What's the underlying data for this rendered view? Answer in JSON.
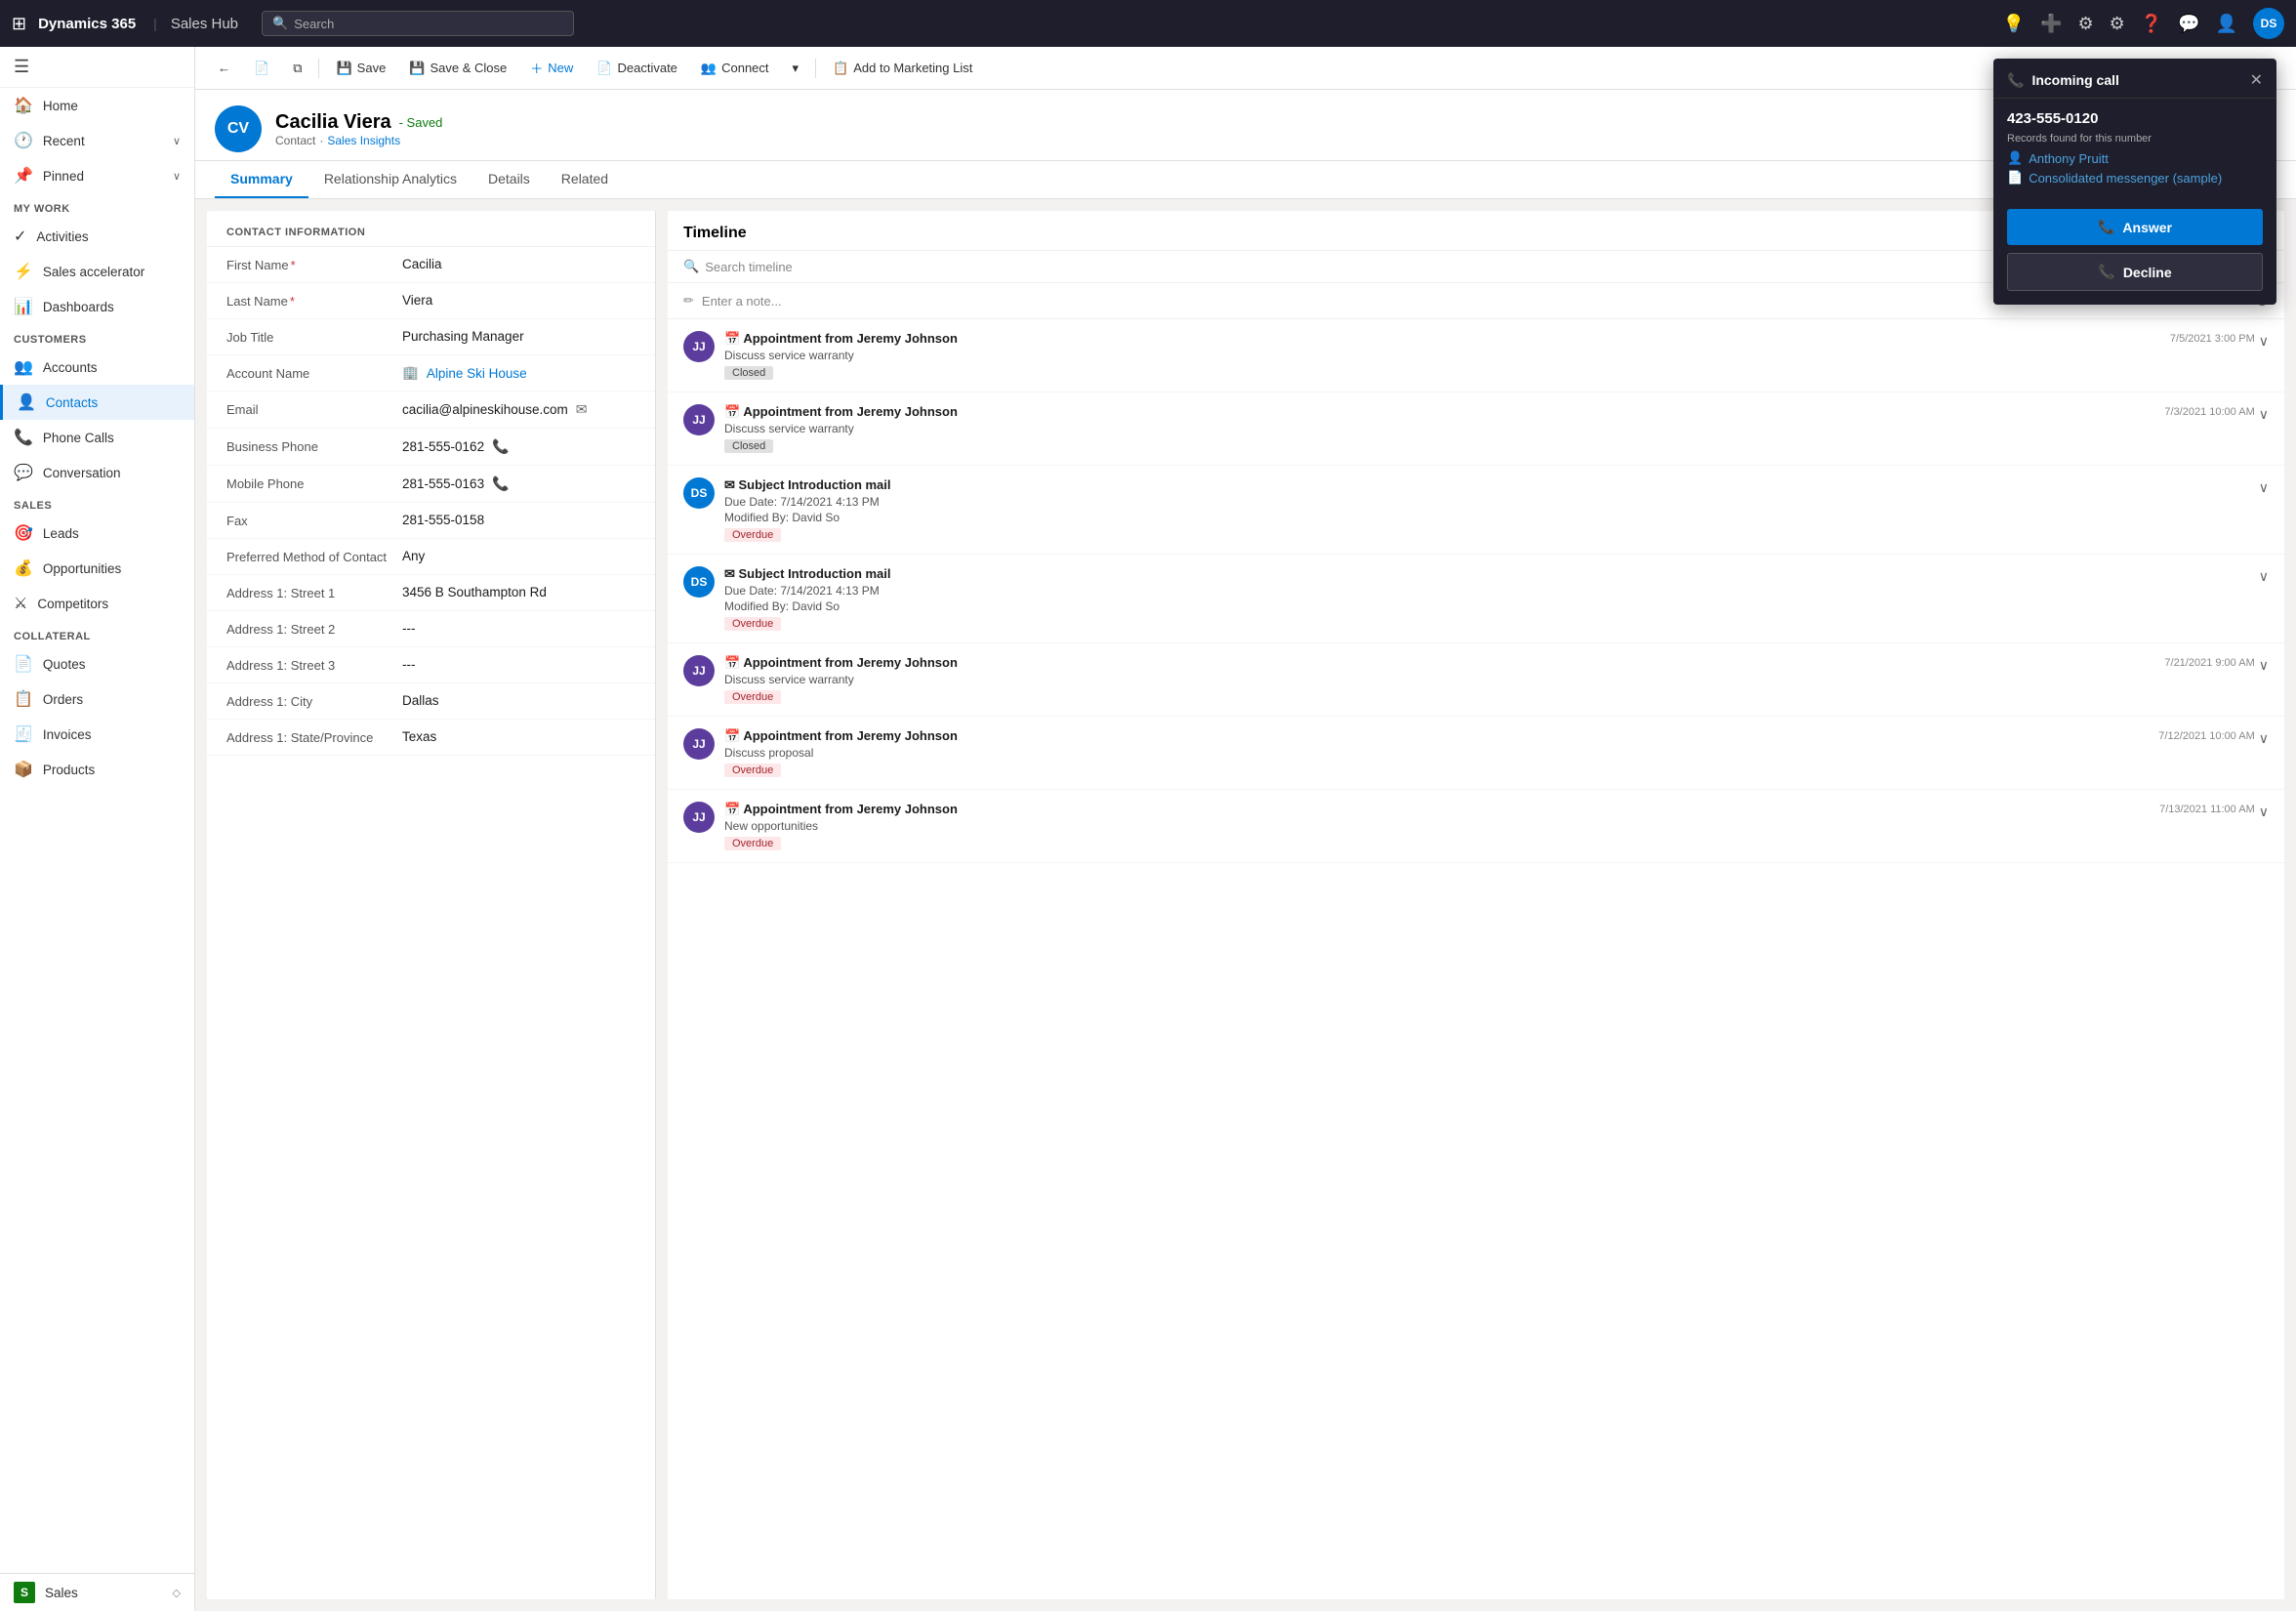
{
  "topNav": {
    "appName": "Dynamics 365",
    "hubName": "Sales Hub",
    "searchPlaceholder": "Search",
    "avatarInitials": "DS"
  },
  "toolbar": {
    "backIcon": "←",
    "saveLabel": "Save",
    "saveCloseLabel": "Save & Close",
    "newLabel": "New",
    "deactivateLabel": "Deactivate",
    "connectLabel": "Connect",
    "addToMarketingListLabel": "Add to Marketing List"
  },
  "contact": {
    "avatarInitials": "CV",
    "name": "Cacilia Viera",
    "savedLabel": "- Saved",
    "type": "Contact",
    "insights": "Sales Insights"
  },
  "tabs": [
    {
      "id": "summary",
      "label": "Summary",
      "active": true
    },
    {
      "id": "relationship",
      "label": "Relationship Analytics",
      "active": false
    },
    {
      "id": "details",
      "label": "Details",
      "active": false
    },
    {
      "id": "related",
      "label": "Related",
      "active": false
    }
  ],
  "contactInfo": {
    "sectionTitle": "CONTACT INFORMATION",
    "fields": [
      {
        "label": "First Name",
        "value": "Cacilia",
        "required": true,
        "type": "text"
      },
      {
        "label": "Last Name",
        "value": "Viera",
        "required": true,
        "type": "text"
      },
      {
        "label": "Job Title",
        "value": "Purchasing Manager",
        "required": false,
        "type": "text"
      },
      {
        "label": "Account Name",
        "value": "Alpine Ski House",
        "required": false,
        "type": "link"
      },
      {
        "label": "Email",
        "value": "cacilia@alpineskihouse.com",
        "required": false,
        "type": "email"
      },
      {
        "label": "Business Phone",
        "value": "281-555-0162",
        "required": false,
        "type": "phone"
      },
      {
        "label": "Mobile Phone",
        "value": "281-555-0163",
        "required": false,
        "type": "phone"
      },
      {
        "label": "Fax",
        "value": "281-555-0158",
        "required": false,
        "type": "text"
      },
      {
        "label": "Preferred Method of Contact",
        "value": "Any",
        "required": false,
        "type": "text"
      },
      {
        "label": "Address 1: Street 1",
        "value": "3456 B Southampton Rd",
        "required": false,
        "type": "text"
      },
      {
        "label": "Address 1: Street 2",
        "value": "---",
        "required": false,
        "type": "text"
      },
      {
        "label": "Address 1: Street 3",
        "value": "---",
        "required": false,
        "type": "text"
      },
      {
        "label": "Address 1: City",
        "value": "Dallas",
        "required": false,
        "type": "text"
      },
      {
        "label": "Address 1: State/Province",
        "value": "Texas",
        "required": false,
        "type": "text"
      }
    ]
  },
  "timeline": {
    "title": "Timeline",
    "searchPlaceholder": "Search timeline",
    "notePlaceholder": "Enter a note...",
    "items": [
      {
        "avatarInitials": "JJ",
        "avatarColor": "#5c3d9e",
        "icon": "📅",
        "title": "Appointment from Jeremy Johnson",
        "subtitle": "Discuss service warranty",
        "badge": "Closed",
        "badgeType": "closed",
        "date": "7/5/2021 3:00 PM",
        "hasDate": true
      },
      {
        "avatarInitials": "JJ",
        "avatarColor": "#5c3d9e",
        "icon": "📅",
        "title": "Appointment from Jeremy Johnson",
        "subtitle": "Discuss service warranty",
        "badge": "Closed",
        "badgeType": "closed",
        "date": "7/3/2021 10:00 AM",
        "hasDate": true
      },
      {
        "avatarInitials": "DS",
        "avatarColor": "#0078d4",
        "icon": "✉",
        "title": "Subject Introduction mail",
        "subtitle": "Due Date: 7/14/2021 4:13 PM",
        "subtitle2": "Modified By: David So",
        "badge": "Overdue",
        "badgeType": "overdue",
        "date": "",
        "hasDate": false
      },
      {
        "avatarInitials": "DS",
        "avatarColor": "#0078d4",
        "icon": "✉",
        "title": "Subject Introduction mail",
        "subtitle": "Due Date: 7/14/2021 4:13 PM",
        "subtitle2": "Modified By: David So",
        "badge": "Overdue",
        "badgeType": "overdue",
        "date": "",
        "hasDate": false
      },
      {
        "avatarInitials": "JJ",
        "avatarColor": "#5c3d9e",
        "icon": "📅",
        "title": "Appointment from Jeremy Johnson",
        "subtitle": "Discuss service warranty",
        "badge": "Overdue",
        "badgeType": "overdue",
        "date": "7/21/2021 9:00 AM",
        "hasDate": true
      },
      {
        "avatarInitials": "JJ",
        "avatarColor": "#5c3d9e",
        "icon": "📅",
        "title": "Appointment from Jeremy Johnson",
        "subtitle": "Discuss proposal",
        "badge": "Overdue",
        "badgeType": "overdue",
        "date": "7/12/2021 10:00 AM",
        "hasDate": true
      },
      {
        "avatarInitials": "JJ",
        "avatarColor": "#5c3d9e",
        "icon": "📅",
        "title": "Appointment from Jeremy Johnson",
        "subtitle": "New opportunities",
        "badge": "Overdue",
        "badgeType": "overdue",
        "date": "7/13/2021 11:00 AM",
        "hasDate": true
      }
    ]
  },
  "sidebar": {
    "sections": [
      {
        "label": "",
        "items": [
          {
            "id": "home",
            "label": "Home",
            "icon": "🏠"
          },
          {
            "id": "recent",
            "label": "Recent",
            "icon": "🕐",
            "expand": true
          },
          {
            "id": "pinned",
            "label": "Pinned",
            "icon": "📌",
            "expand": true
          }
        ]
      },
      {
        "label": "My Work",
        "items": [
          {
            "id": "activities",
            "label": "Activities",
            "icon": "✓"
          },
          {
            "id": "sales-accelerator",
            "label": "Sales accelerator",
            "icon": "⚡"
          },
          {
            "id": "dashboards",
            "label": "Dashboards",
            "icon": "📊"
          }
        ]
      },
      {
        "label": "Customers",
        "items": [
          {
            "id": "accounts",
            "label": "Accounts",
            "icon": "👥"
          },
          {
            "id": "contacts",
            "label": "Contacts",
            "icon": "👤",
            "active": true
          }
        ]
      },
      {
        "label": "",
        "items": [
          {
            "id": "phone-calls",
            "label": "Phone Calls",
            "icon": "📞"
          },
          {
            "id": "conversation",
            "label": "Conversation",
            "icon": "💬"
          }
        ]
      },
      {
        "label": "Sales",
        "items": [
          {
            "id": "leads",
            "label": "Leads",
            "icon": "🎯"
          },
          {
            "id": "opportunities",
            "label": "Opportunities",
            "icon": "💰"
          },
          {
            "id": "competitors",
            "label": "Competitors",
            "icon": "⚔"
          }
        ]
      },
      {
        "label": "Collateral",
        "items": [
          {
            "id": "quotes",
            "label": "Quotes",
            "icon": "📄"
          },
          {
            "id": "orders",
            "label": "Orders",
            "icon": "📋"
          },
          {
            "id": "invoices",
            "label": "Invoices",
            "icon": "🧾"
          },
          {
            "id": "products",
            "label": "Products",
            "icon": "📦"
          }
        ]
      },
      {
        "label": "",
        "items": [
          {
            "id": "sales-bottom",
            "label": "Sales",
            "icon": "S",
            "special": true
          }
        ]
      }
    ]
  },
  "incomingCall": {
    "title": "Incoming call",
    "phoneIcon": "📞",
    "number": "423-555-0120",
    "recordsLabel": "Records found for this number",
    "records": [
      {
        "id": "anthony",
        "label": "Anthony Pruitt",
        "icon": "👤"
      },
      {
        "id": "messenger",
        "label": "Consolidated messenger (sample)",
        "icon": "📄"
      }
    ],
    "answerLabel": "Answer",
    "declineLabel": "Decline"
  }
}
